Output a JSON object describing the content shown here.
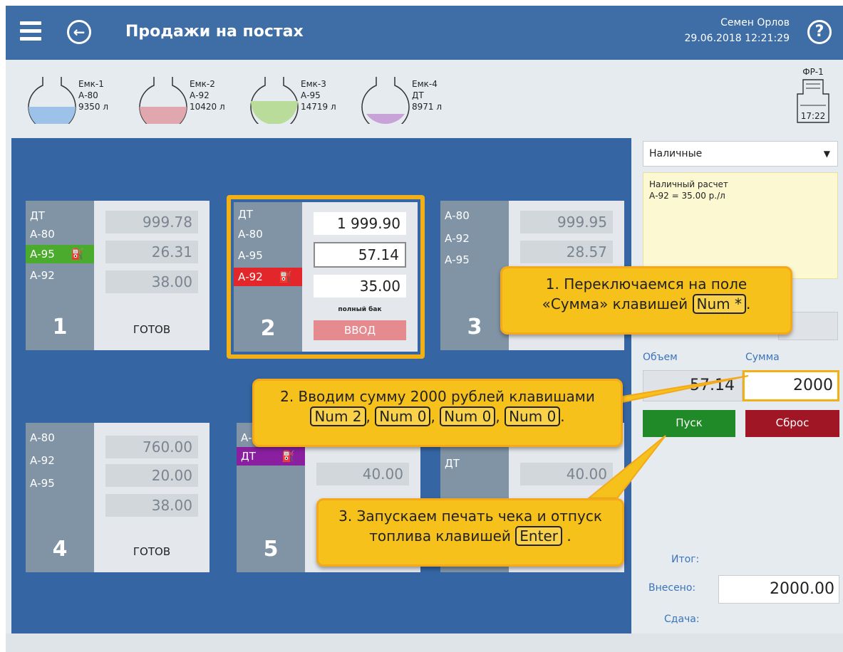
{
  "header": {
    "title": "Продажи на постах",
    "user": "Семен Орлов",
    "datetime": "29.06.2018 12:21:29",
    "help_glyph": "?",
    "back_glyph": "←"
  },
  "tanks": [
    {
      "name": "Емк-1",
      "fuel": "А-80",
      "volume": "9350 л",
      "color": "#9cc2ea",
      "level": 0.35
    },
    {
      "name": "Емк-2",
      "fuel": "А-92",
      "volume": "10420 л",
      "color": "#e1a7ae",
      "level": 0.38
    },
    {
      "name": "Емк-3",
      "fuel": "А-95",
      "volume": "14719 л",
      "color": "#b9dc9b",
      "level": 0.6
    },
    {
      "name": "Емк-4",
      "fuel": "ДТ",
      "volume": "8971 л",
      "color": "#c8a3d8",
      "level": 0.15
    }
  ],
  "fiscal": {
    "label": "ФР-1",
    "time": "17:22"
  },
  "stations": {
    "s1": {
      "fuels": [
        "ДТ",
        "А-80",
        "А-95",
        "А-92"
      ],
      "values": [
        "999.78",
        "26.31",
        "38.00"
      ],
      "num": "1",
      "status": "ГОТОВ"
    },
    "s2": {
      "fuels": [
        "ДТ",
        "А-80",
        "А-95",
        "А-92"
      ],
      "values": [
        "1 999.90",
        "57.14",
        "35.00"
      ],
      "num": "2",
      "note": "полный бак",
      "button": "ВВОД"
    },
    "s3": {
      "fuels": [
        "А-80",
        "А-92",
        "А-95"
      ],
      "values": [
        "999.95",
        "28.57"
      ],
      "num": "3"
    },
    "s4": {
      "fuels": [
        "А-80",
        "А-92",
        "А-95"
      ],
      "values": [
        "760.00",
        "20.00",
        "38.00"
      ],
      "num": "4",
      "status": "ГОТОВ"
    },
    "s5": {
      "fuels": [
        "А-8",
        "ДТ"
      ],
      "values": [
        "40.00"
      ],
      "num": "5"
    },
    "s6": {
      "fuels": [
        "ДТ"
      ],
      "values": [
        "40.00"
      ]
    }
  },
  "nozzle_glyph": "⛽",
  "payment": {
    "method": "Наличные",
    "dropdown_glyph": "▼",
    "note_line1": "Наличный расчет",
    "note_line2": "А-92 = 35.00 р./л",
    "volume_label": "Объем",
    "sum_label": "Сумма",
    "volume_value": "57.14",
    "sum_value": "2000",
    "start": "Пуск",
    "reset": "Сброс",
    "total_label": "Итог:",
    "paid_label": "Внесено:",
    "paid_value": "2000.00",
    "change_label": "Сдача:"
  },
  "callouts": {
    "c1_line1": "1. Переключаемся на поле",
    "c1_line2a": "«Сумма» клавишей",
    "c1_key": "Num *",
    "c1_end": ".",
    "c2_line1": "2. Вводим сумму 2000 рублей клавишами",
    "c2_keys": [
      "Num 2",
      "Num 0",
      "Num 0",
      "Num 0"
    ],
    "c2_sep": ",",
    "c2_end": ".",
    "c3_line1": "3. Запускаем печать чека и отпуск",
    "c3_line2a": "топлива клавишей",
    "c3_key": "Enter",
    "c3_end": "."
  }
}
